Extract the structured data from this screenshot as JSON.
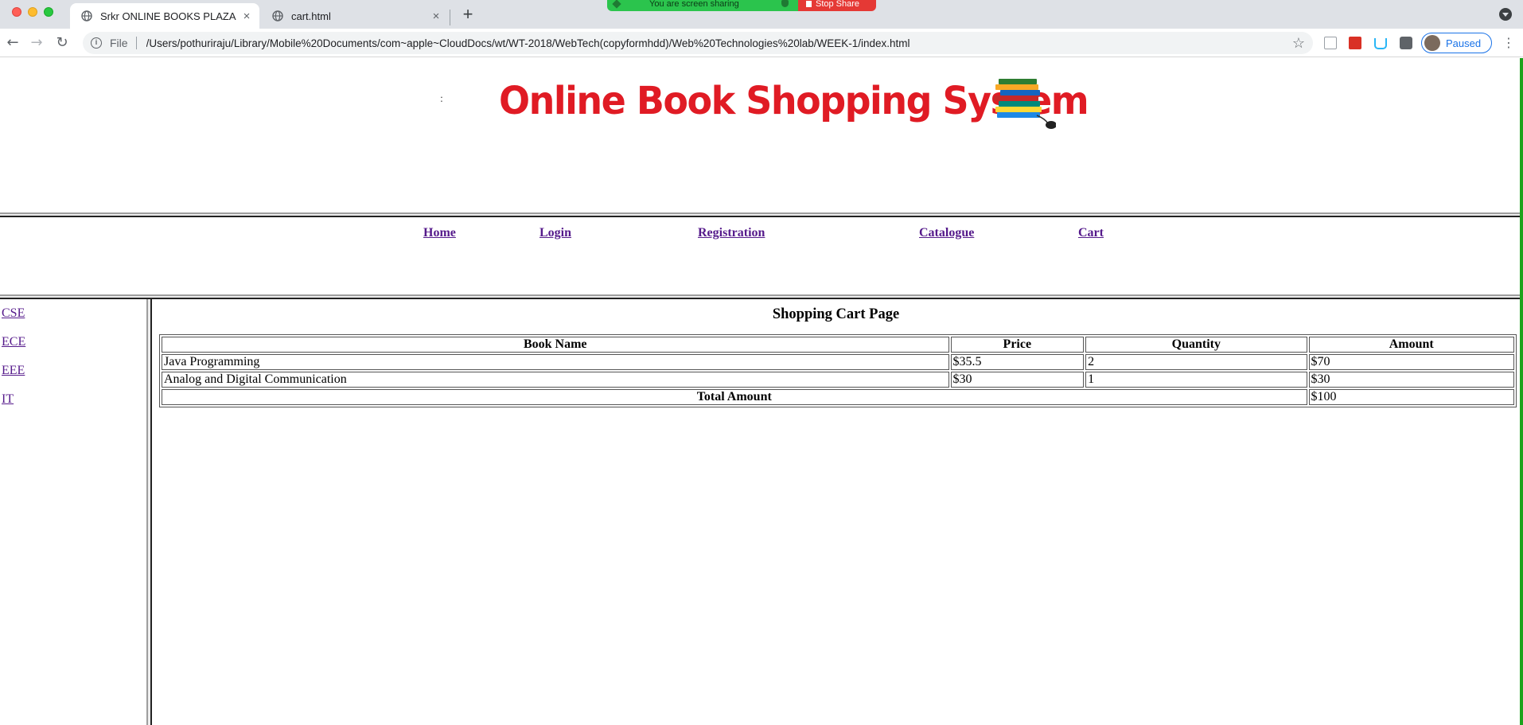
{
  "browser": {
    "tabs": [
      {
        "title": "Srkr ONLINE BOOKS PLAZA",
        "active": true
      },
      {
        "title": "cart.html",
        "active": false
      }
    ],
    "close_glyph": "×",
    "new_tab_glyph": "+",
    "url_scheme": "File",
    "url": "/Users/pothuriraju/Library/Mobile%20Documents/com~apple~CloudDocs/wt/WT-2018/WebTech(copyformhdd)/Web%20Technologies%20lab/WEEK-1/index.html",
    "profile_status": "Paused",
    "screen_share": {
      "message": "You are screen sharing",
      "stop_label": "Stop Share"
    }
  },
  "banner": {
    "text": "Online Book Shopping System",
    "dot": ":"
  },
  "nav": {
    "links": [
      "Home",
      "Login",
      "Registration",
      "Catalogue",
      "Cart"
    ]
  },
  "sidebar": {
    "links": [
      "CSE",
      "ECE",
      "EEE",
      "IT"
    ]
  },
  "cart": {
    "title": "Shopping Cart Page",
    "columns": [
      "Book Name",
      "Price",
      "Quantity",
      "Amount"
    ],
    "rows": [
      {
        "book": "Java Programming",
        "price": "$35.5",
        "quantity": "2",
        "amount": "$70"
      },
      {
        "book": "Analog and Digital Communication",
        "price": "$30",
        "quantity": "1",
        "amount": "$30"
      }
    ],
    "total_label": "Total Amount",
    "total_value": "$100"
  },
  "colors": {
    "link_visited": "#551a8b",
    "banner_red": "#e01b24",
    "scrollbar_green": "#1ba31b"
  }
}
